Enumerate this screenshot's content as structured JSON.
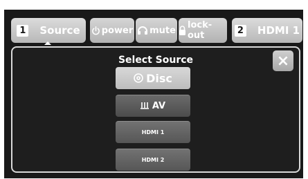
{
  "topbar": {
    "source_tab": {
      "number": "1",
      "label": "Source"
    },
    "power_label": "power",
    "mute_label": "mute",
    "lockout_label": "lock-out",
    "active_source_tab": {
      "number": "2",
      "label": "HDMI 1"
    }
  },
  "panel": {
    "title": "Select Source",
    "close_label": "×",
    "sources": [
      {
        "label": "Disc",
        "icon": "disc-icon",
        "selected": true
      },
      {
        "label": "AV",
        "icon": "av-cable-icon",
        "selected": false
      },
      {
        "label": "HDMI 1",
        "selected": false
      },
      {
        "label": "HDMI 2",
        "selected": false
      }
    ]
  },
  "colors": {
    "screen_bg": "#191919",
    "button_light": "#c8c8c8",
    "button_dark": "#5c5c5c",
    "text": "#ffffff"
  }
}
